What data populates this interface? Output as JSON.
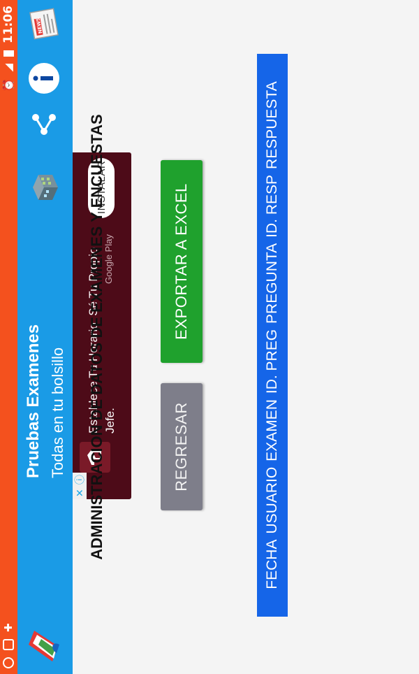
{
  "status_bar": {
    "left_icons": [
      "whatsapp-icon",
      "gallery-icon",
      "plus-icon"
    ],
    "right_icons": [
      "alarm-icon",
      "signal-icon",
      "battery-icon"
    ],
    "time": "11:06"
  },
  "app_bar": {
    "title": "Pruebas Examenes",
    "subtitle": "Todas en tu bolsillo",
    "actions": [
      "building-icon",
      "share-icon",
      "info-icon",
      "news-icon"
    ],
    "news_label": "NEWS"
  },
  "ad": {
    "text": "Establece Tu Horario. Sé Tu Propio Jefe.",
    "store": "Google Play",
    "install_label": "INSTALAR"
  },
  "main": {
    "heading": "ADMINISTRACION DE DATOS DE EXAMENES Y ENCUESTAS",
    "back_label": "REGRESAR",
    "export_label": "EXPORTAR A EXCEL",
    "columns": [
      "FECHA",
      "USUARIO",
      "EXAMEN",
      "ID. PREG",
      "PREGUNTA",
      "ID. RESP",
      "RESPUESTA"
    ]
  },
  "colors": {
    "status_bar": "#f4511e",
    "app_bar": "#1a9be6",
    "ad_background": "#4d0b18",
    "export_button": "#1fa12d",
    "back_button": "#7e7e8a",
    "table_header": "#1565e8"
  }
}
